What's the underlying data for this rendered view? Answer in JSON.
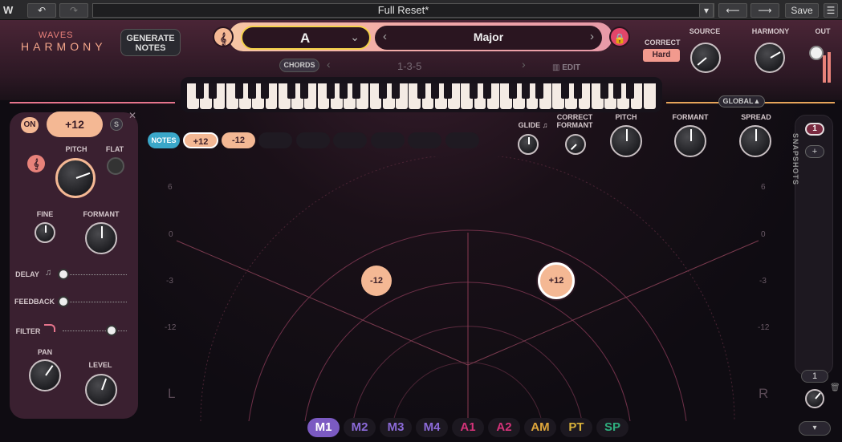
{
  "toolbar": {
    "undo_label": "↶",
    "redo_label": "↷",
    "preset_name": "Full Reset*",
    "preset_dropdown": "▾",
    "prev_label": "⟵",
    "next_label": "⟶",
    "save_label": "Save",
    "menu_label": "☰"
  },
  "logo": {
    "top": "WAVES",
    "bottom": "HARMONY"
  },
  "generate_notes": {
    "line1": "GENERATE",
    "line2": "NOTES"
  },
  "key": {
    "value": "A",
    "scale": "Major"
  },
  "chords": {
    "label": "CHORDS",
    "value": "1-3-5",
    "edit_label": "EDIT"
  },
  "correct": {
    "label": "CORRECT",
    "value": "Hard"
  },
  "top_knobs": {
    "source": "SOURCE",
    "harmony": "HARMONY",
    "out": "OUT"
  },
  "global_label": "GLOBAL▲",
  "left_panel": {
    "on_label": "ON",
    "voice_value": "+12",
    "solo_label": "S",
    "close_label": "✕",
    "pitch": "PITCH",
    "flat": "FLAT",
    "fine": "FINE",
    "formant": "FORMANT",
    "delay": "DELAY",
    "feedback": "FEEDBACK",
    "filter": "FILTER",
    "pan": "PAN",
    "level": "LEVEL"
  },
  "notes_bar": {
    "label": "NOTES",
    "chips": [
      "+12",
      "-12"
    ]
  },
  "global_knobs": {
    "glide": "GLIDE",
    "correct_formant_1": "CORRECT",
    "correct_formant_2": "FORMANT",
    "pitch": "PITCH",
    "formant": "FORMANT",
    "spread": "SPREAD"
  },
  "radar": {
    "left_axis": [
      "6",
      "0",
      "-3",
      "-12"
    ],
    "right_axis": [
      "6",
      "0",
      "-3",
      "-12"
    ],
    "left_label": "L",
    "right_label": "R",
    "voices": [
      {
        "label": "-12",
        "selected": false
      },
      {
        "label": "+12",
        "selected": true
      }
    ]
  },
  "snapshots": {
    "label": "SNAPSHOTS",
    "slot": "1",
    "add": "+",
    "bottom_value": "1"
  },
  "modes": [
    {
      "label": "M1",
      "color": "#a78bfa",
      "active": true
    },
    {
      "label": "M2",
      "color": "#8b6ad8",
      "active": false
    },
    {
      "label": "M3",
      "color": "#8b6ad8",
      "active": false
    },
    {
      "label": "M4",
      "color": "#8b6ad8",
      "active": false
    },
    {
      "label": "A1",
      "color": "#d6337a",
      "active": false
    },
    {
      "label": "A2",
      "color": "#d6337a",
      "active": false
    },
    {
      "label": "AM",
      "color": "#e0a73b",
      "active": false
    },
    {
      "label": "PT",
      "color": "#d9b23a",
      "active": false
    },
    {
      "label": "SP",
      "color": "#2fae7e",
      "active": false
    }
  ]
}
